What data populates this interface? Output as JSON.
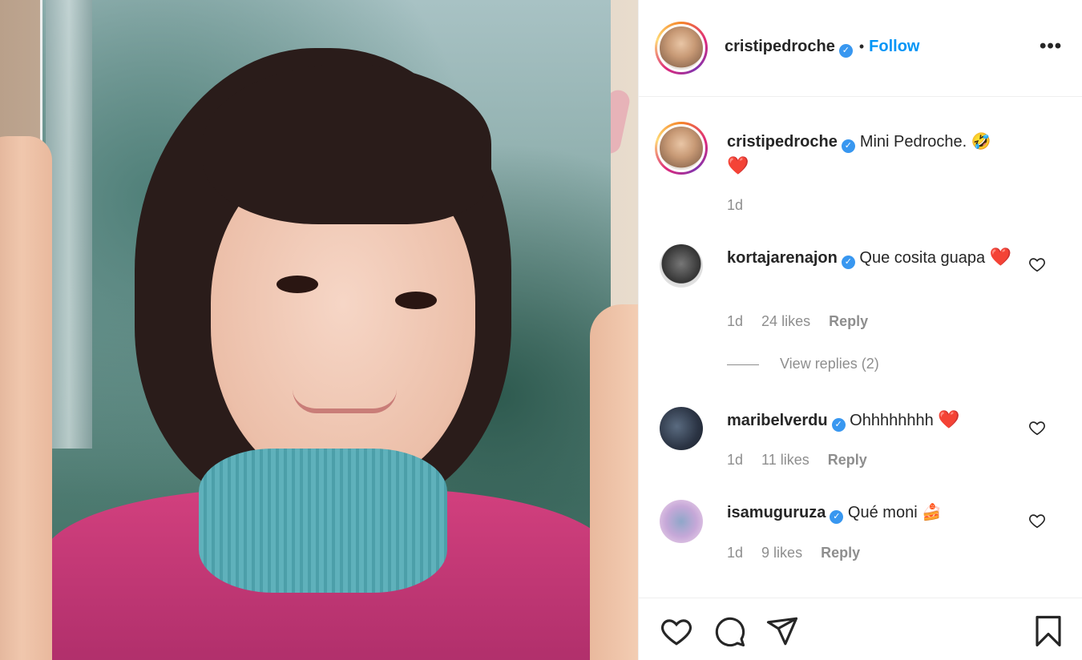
{
  "post": {
    "author": "cristipedroche",
    "follow_label": "Follow",
    "separator": "•",
    "more_label": "•••",
    "caption": "Mini Pedroche. 🤣",
    "caption_heart": "❤️",
    "caption_time": "1d"
  },
  "comments": [
    {
      "user": "kortajarenajon",
      "text": "Que cosita guapa",
      "emoji": "❤️",
      "time": "1d",
      "likes": "24 likes",
      "reply": "Reply",
      "view_replies": "View replies (2)"
    },
    {
      "user": "maribelverdu",
      "text": "Ohhhhhhhh",
      "emoji": "❤️",
      "time": "1d",
      "likes": "11 likes",
      "reply": "Reply"
    },
    {
      "user": "isamuguruza",
      "text": "Qué moni",
      "emoji": "🍰",
      "time": "1d",
      "likes": "9 likes",
      "reply": "Reply"
    }
  ],
  "icons": {
    "verified": "verified-badge-icon",
    "like": "heart-icon",
    "comment": "comment-icon",
    "share": "share-icon",
    "save": "bookmark-icon",
    "more": "more-options-icon"
  },
  "colors": {
    "follow": "#0095f6",
    "verified": "#3897f0",
    "muted": "#8e8e8e",
    "heart": "#ed4956"
  }
}
